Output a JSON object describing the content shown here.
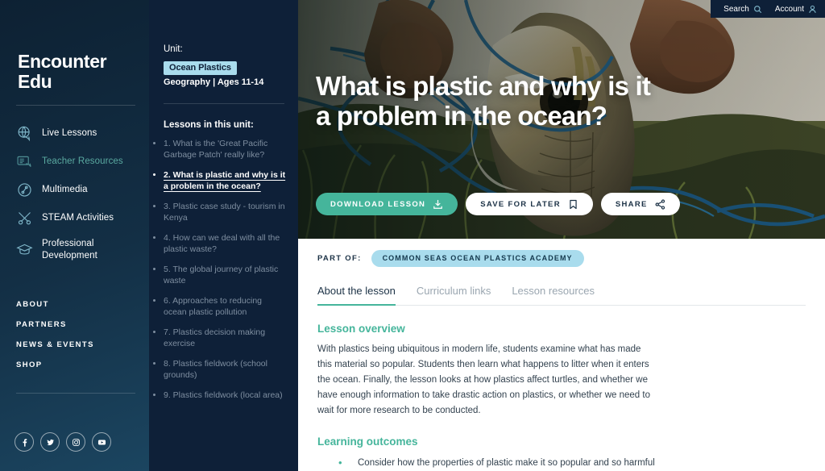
{
  "brand": {
    "line1": "Encounter",
    "line2": "Edu"
  },
  "topbar": {
    "search_label": "Search",
    "search_icon": "search-icon",
    "account_label": "Account",
    "account_icon": "user-icon"
  },
  "sidebar": {
    "primary_items": [
      {
        "label": "Live Lessons",
        "icon": "globe-chat-icon",
        "active": false
      },
      {
        "label": "Teacher Resources",
        "icon": "resource-card-icon",
        "active": true
      },
      {
        "label": "Multimedia",
        "icon": "play-circle-icon",
        "active": false
      },
      {
        "label": "STEAM Activities",
        "icon": "tools-cross-icon",
        "active": false
      },
      {
        "label": "Professional Development",
        "icon": "graduation-cap-icon",
        "active": false
      }
    ],
    "secondary_items": [
      {
        "label": "ABOUT"
      },
      {
        "label": "PARTNERS"
      },
      {
        "label": "NEWS & EVENTS"
      },
      {
        "label": "SHOP"
      }
    ],
    "socials": [
      {
        "name": "facebook-icon"
      },
      {
        "name": "twitter-icon"
      },
      {
        "name": "instagram-icon"
      },
      {
        "name": "youtube-icon"
      }
    ]
  },
  "unit_panel": {
    "unit_label": "Unit:",
    "unit_name": "Ocean Plastics",
    "unit_meta": "Geography | Ages 11-14",
    "lessons_heading": "Lessons in this unit:",
    "lessons": [
      {
        "label": "1. What is the 'Great Pacific Garbage Patch' really like?",
        "active": false
      },
      {
        "label": "2. What is plastic and why is it a problem in the ocean?",
        "active": true
      },
      {
        "label": "3. Plastic case study - tourism in Kenya",
        "active": false
      },
      {
        "label": "4. How can we deal with all the plastic waste?",
        "active": false
      },
      {
        "label": "5. The global journey of plastic waste",
        "active": false
      },
      {
        "label": "6. Approaches to reducing ocean plastic pollution",
        "active": false
      },
      {
        "label": "7. Plastics decision making exercise",
        "active": false
      },
      {
        "label": "8. Plastics fieldwork (school grounds)",
        "active": false
      },
      {
        "label": "9. Plastics fieldwork (local area)",
        "active": false
      }
    ]
  },
  "hero": {
    "title": "What is plastic and why is it a problem in the ocean?",
    "image_description": "sea-turtle-entangled-in-blue-fishing-net-held-by-hands-on-beach",
    "actions": [
      {
        "label": "DOWNLOAD LESSON",
        "icon": "download-icon",
        "style": "primary"
      },
      {
        "label": "SAVE FOR LATER",
        "icon": "bookmark-icon",
        "style": "ghost"
      },
      {
        "label": "SHARE",
        "icon": "share-icon",
        "style": "ghost"
      }
    ]
  },
  "content": {
    "part_of_label": "PART OF:",
    "part_of_value": "COMMON SEAS OCEAN PLASTICS ACADEMY",
    "tabs": [
      {
        "label": "About the lesson",
        "active": true
      },
      {
        "label": "Curriculum links",
        "active": false
      },
      {
        "label": "Lesson resources",
        "active": false
      }
    ],
    "overview_heading": "Lesson overview",
    "overview_text": "With plastics being ubiquitous in modern life, students examine what has made this material so popular. Students then learn what happens to litter when it enters the ocean. Finally, the lesson looks at how plastics affect turtles, and whether we have enough information to take drastic action on plastics, or whether we need to wait for more research to be conducted.",
    "outcomes_heading": "Learning outcomes",
    "outcomes": [
      "Consider how the properties of plastic make it so popular and so harmful"
    ]
  },
  "colors": {
    "accent_teal": "#45b59b",
    "chip_blue": "#a9dced",
    "sidebar_navy": "#0d2133",
    "unit_navy": "#0e2038",
    "active_nav": "#5aa9a0"
  }
}
